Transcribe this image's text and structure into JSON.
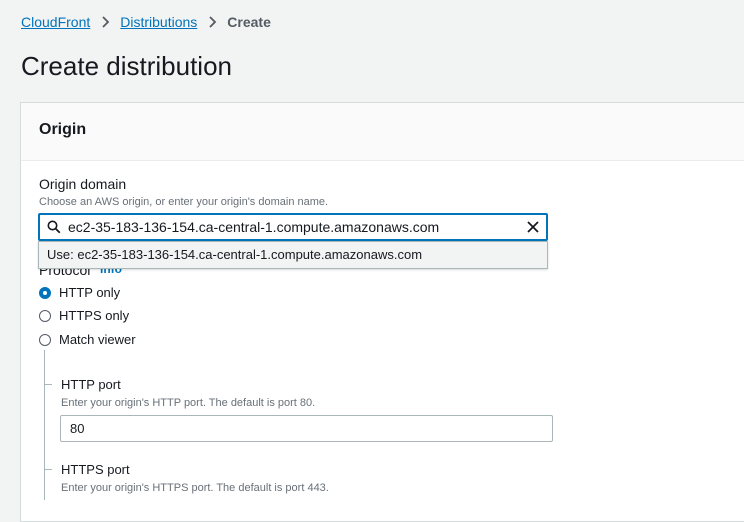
{
  "breadcrumb": {
    "items": [
      "CloudFront",
      "Distributions"
    ],
    "current": "Create"
  },
  "page": {
    "title": "Create distribution"
  },
  "origin": {
    "section_title": "Origin",
    "domain": {
      "label": "Origin domain",
      "description": "Choose an AWS origin, or enter your origin's domain name.",
      "value": "ec2-35-183-136-154.ca-central-1.compute.amazonaws.com",
      "suggestion": "Use: ec2-35-183-136-154.ca-central-1.compute.amazonaws.com"
    },
    "protocol": {
      "label": "Protocol",
      "info": "Info",
      "options": [
        "HTTP only",
        "HTTPS only",
        "Match viewer"
      ],
      "selected": "HTTP only"
    },
    "http_port": {
      "label": "HTTP port",
      "description": "Enter your origin's HTTP port. The default is port 80.",
      "value": "80"
    },
    "https_port": {
      "label": "HTTPS port",
      "description": "Enter your origin's HTTPS port. The default is port 443."
    }
  },
  "icons": {
    "search": "search-icon",
    "clear": "close-icon",
    "separator": "chevron-right-icon"
  },
  "colors": {
    "link": "#0073bb",
    "accent": "#0073bb",
    "background": "#f2f3f3"
  }
}
